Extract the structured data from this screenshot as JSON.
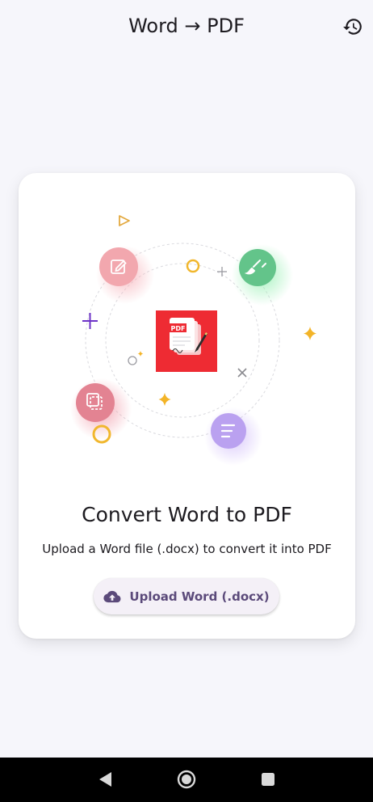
{
  "app_bar": {
    "title": "Word → PDF",
    "history_icon": "history-icon"
  },
  "card": {
    "illustration": {
      "center_badge_text": "PDF",
      "icons": [
        "edit-icon",
        "brush-icon",
        "copy-icon",
        "notes-icon",
        "pdf-document-icon"
      ],
      "colors": {
        "pdf_red": "#ee2b33",
        "edit_pink": "#f0a0a8",
        "brush_green": "#5fc58a",
        "copy_pink": "#e2818f",
        "notes_purple": "#b9a2ef",
        "accent_gold": "#f3b428",
        "accent_purple": "#6d33c7"
      }
    },
    "title": "Convert Word to PDF",
    "subtitle": "Upload a Word file (.docx) to convert it into PDF",
    "upload_button": {
      "label": "Upload Word (.docx)",
      "icon": "cloud-upload-icon"
    }
  },
  "system_nav": {
    "items": [
      "back-icon",
      "home-icon",
      "recents-icon"
    ]
  }
}
